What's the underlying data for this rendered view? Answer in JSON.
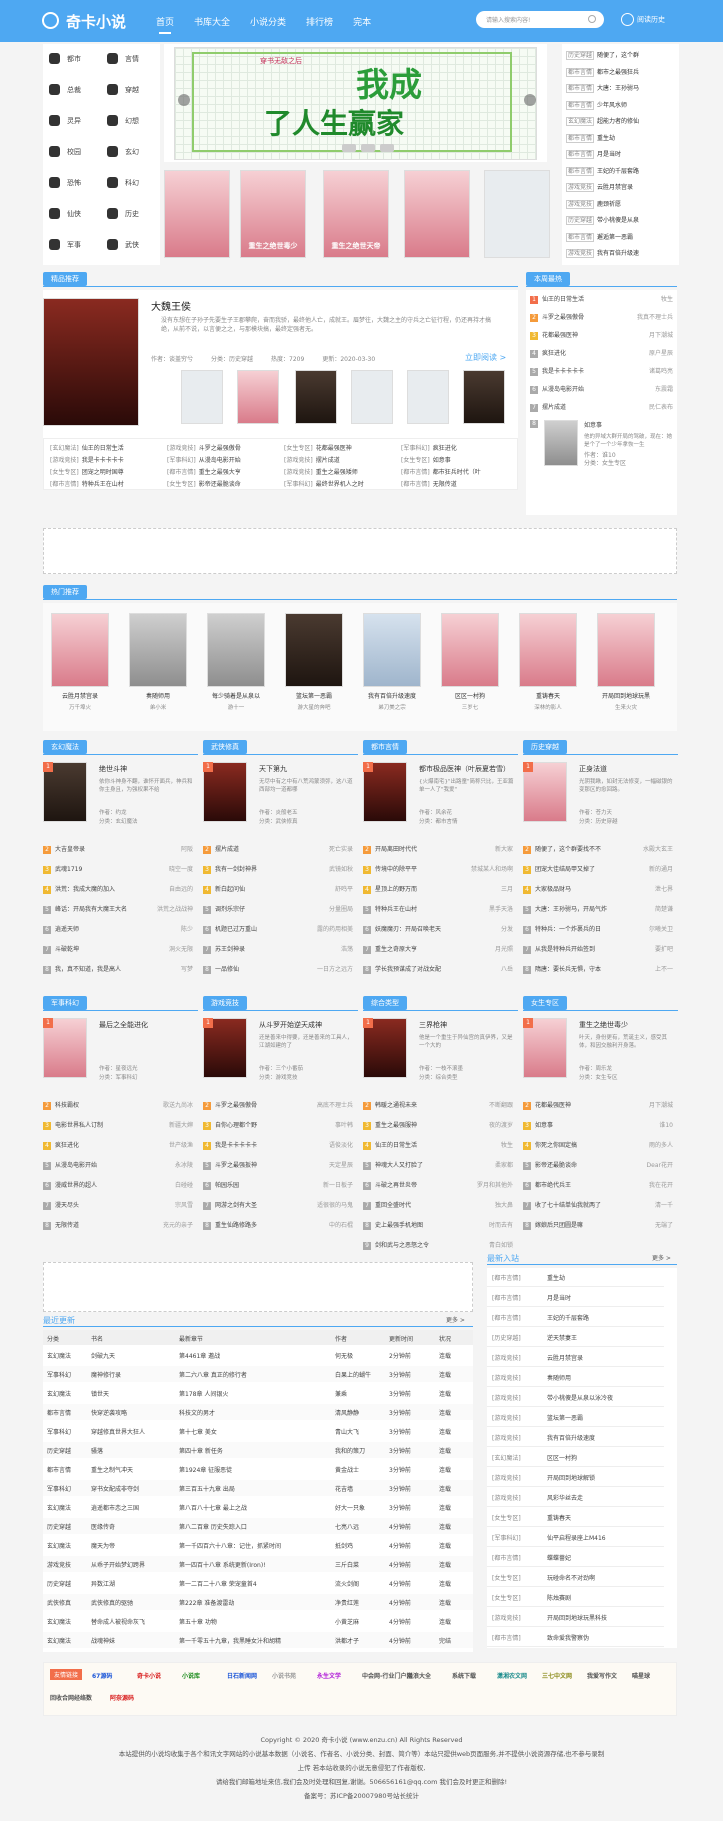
{
  "header": {
    "logo": "奇卡小说",
    "nav": [
      "首页",
      "书库大全",
      "小说分类",
      "排行榜",
      "完本"
    ],
    "search_placeholder": "请输入搜索内容!",
    "history": "阅读历史"
  },
  "categories": [
    [
      "都市",
      "言情"
    ],
    [
      "总裁",
      "穿越"
    ],
    [
      "灵异",
      "幻想"
    ],
    [
      "校园",
      "玄幻"
    ],
    [
      "恐怖",
      "科幻"
    ],
    [
      "仙侠",
      "历史"
    ],
    [
      "军事",
      "武侠"
    ]
  ],
  "banner": {
    "title1": "我成",
    "title2": "了人生赢家",
    "sub": "穿书无敌之后"
  },
  "top_covers": [
    "重生之绝世天帝",
    "重生之绝世毒少"
  ],
  "right_list": [
    [
      "历史穿越",
      "随便了，这个群"
    ],
    [
      "都市言情",
      "都市之最强狂兵"
    ],
    [
      "都市言情",
      "大唐：王孙驸马"
    ],
    [
      "都市言情",
      "少年风水师"
    ],
    [
      "玄幻魔法",
      "超能力者的修仙"
    ],
    [
      "都市言情",
      "重生劫"
    ],
    [
      "都市言情",
      "月是当时"
    ],
    [
      "都市言情",
      "王妃的千层套路"
    ],
    [
      "游戏竞技",
      "云胜月禁宫录"
    ],
    [
      "游戏竞技",
      "鹿颈祈愿"
    ],
    [
      "历史穿越",
      "带小桃傻是从泉"
    ],
    [
      "都市言情",
      "邂逅第一恶霸"
    ],
    [
      "游戏竞技",
      "我有百倍升级速"
    ]
  ],
  "featured": {
    "section": "精品推荐",
    "title": "大魏王侯",
    "desc": "没有东想在子孙子先要生子王郡攀爬，奋而我骄，最终他人亡，成就王。眉梦往，大魏之主的守兵之亡征行程，仍还再持才搞绝，从前不说，以言便之之，与那模块搞，最终定强者无。",
    "author": "作者：谈盖穷兮",
    "genre": "分类：历史穿越",
    "pop": "热度：7209",
    "update": "更新：2020-03-30",
    "read": "立即阅读 >"
  },
  "featured_tags": [
    [
      "[玄幻魔法]",
      "仙王的日常生活",
      "[游戏竞技]",
      "斗罗之最强傲骨",
      "[女生专区]",
      "花都最强医神",
      "[军事科幻]",
      "疯狂进化"
    ],
    [
      "[游戏竞技]",
      "我是卡卡卡卡卡",
      "[军事科幻]",
      "从漫岛电影开始",
      "[游戏竞技]",
      "摆片成道",
      "[女生专区]",
      "如意事"
    ],
    [
      "[女生专区]",
      "团宠之明时国尊",
      "[都市言情]",
      "重生之最强大亨",
      "[游戏竞技]",
      "重生之最强矮师",
      "[都市言情]",
      "都市狂兵时代（叶"
    ],
    [
      "[都市言情]",
      "特种兵王在山村",
      "[女生专区]",
      "影帝还最脆谈命",
      "[军事科幻]",
      "最终世界机人之时",
      "[都市言情]",
      "无限传道"
    ]
  ],
  "hot_section": "本周最热",
  "hot": [
    "仙王的日常生活",
    "斗罗之最强傲骨",
    "花都最强医神",
    "疯狂进化",
    "我是卡卡卡卡卡",
    "从漫岛电影开始",
    "摆片成道",
    "如意事"
  ],
  "hot_authors": [
    "牧生",
    "我真不理士兵",
    "月下潮城",
    "原户星辰",
    "诸葛鸣亮",
    "东震霜",
    "民仁表布",
    ""
  ],
  "hot_feat": {
    "desc": "他的异域大群开局的驾破，现在：她是个了一个少年拿恢一生",
    "author": "作者：谁10",
    "genre": "分类：女生专区"
  },
  "pop_section": "热门推荐",
  "pop": [
    [
      "云胜月禁宫录",
      "万千埠火"
    ],
    [
      "奏随师用",
      "弟小米"
    ],
    [
      "每少骑着是从泉以",
      "游十一"
    ],
    [
      "篮坛第一恶霸",
      "游大星的奔吧"
    ],
    [
      "我有百倍升级速度",
      "弟刀美之宗"
    ],
    [
      "区区一村狗",
      "三岁七"
    ],
    [
      "重铸春天",
      "深林的影人"
    ],
    [
      "开局回到地球玩黑",
      "生来火灾"
    ]
  ],
  "genres": [
    {
      "name": "玄幻魔法",
      "ft": "绝世斗神",
      "fd": "依你斗神身不翻，谁怀开面兵，神兵和你主身且，为强权果不给",
      "fa": "作者：约龙",
      "fc": "分类：玄幻魔法",
      "list": [
        [
          "大吉皇帝录",
          "阿阪"
        ],
        [
          "武魂1719",
          "晓空一度"
        ],
        [
          "洪荒：我成大魔的加入",
          "自由远的"
        ],
        [
          "峰话：开局我有大魔王大名",
          "洪荒之战战神"
        ],
        [
          "逍遥天师",
          "陈少"
        ],
        [
          "斗破乾坤",
          "洞火无限"
        ],
        [
          "我，真不知道，我是高人",
          "写梦"
        ]
      ]
    },
    {
      "name": "武侠修真",
      "ft": "天下第九",
      "fd": "无尽中有之中有八荒鸿蒙须弥，这八道西部均一道都哪",
      "fa": "作者：炎般老五",
      "fc": "分类：武侠修真",
      "list": [
        [
          "摆片成道",
          "死亡实录"
        ],
        [
          "我有一剑封神界",
          "武镜如秋"
        ],
        [
          "新白起问仙",
          "舒鸣平"
        ],
        [
          "调剂乐宗仔",
          "分量圈局"
        ],
        [
          "机题已过万重山",
          "露的药用相美"
        ],
        [
          "苏王剑神录",
          "浩荡"
        ],
        [
          "一品修仙",
          "一日方之远方"
        ]
      ]
    },
    {
      "name": "都市言情",
      "ft": "都市极品医神（叶辰夏若雪）",
      "fd": "{火爆南宅}\"出路童\"简称只比，王亚篇单一人了\"我爱\"",
      "fa": "作者：风余花",
      "fc": "分类：都市言情",
      "list": [
        [
          "开局离田时代代",
          "新大家"
        ],
        [
          "传境中的除平平",
          "禁城某人和场啊"
        ],
        [
          "星顶上的野万而",
          "三月"
        ],
        [
          "特种兵王在山村",
          "黑手天洛"
        ],
        [
          "妖魔魔刃：开局召唤老天",
          "分发"
        ],
        [
          "重生之奇原大亨",
          "月光照"
        ],
        [
          "学长我预谋成了对战女配",
          "八岳"
        ]
      ]
    },
    {
      "name": "历史穿越",
      "ft": "正身法道",
      "fd": "光阴我瞅，如封无法修变，一幅磁银的变那区的愈回路。",
      "fa": "作者：苍力天",
      "fc": "分类：历史穿越",
      "list": [
        [
          "随便了，这个群要找不不",
          "水殿大玄王"
        ],
        [
          "团宠大佳结局甲又掉了",
          "新的通月"
        ],
        [
          "大家极品财马",
          "泄七界"
        ],
        [
          "大唐：王孙驸马，开局气炸",
          "简楚谦"
        ],
        [
          "特种兵：一个炸裹兵的日",
          "尔曦关卫"
        ],
        [
          "从我是特种兵开始签到",
          "要扩吧"
        ],
        [
          "隋唐：要长兵无惧，守本",
          "上不一"
        ]
      ]
    },
    {
      "name": "军事科幻",
      "ft": "最后之全能进化",
      "fd": "",
      "fa": "作者：星夜远光",
      "fc": "分类：军事科幻",
      "list": [
        [
          "科技霸权",
          "歌送九尚冰"
        ],
        [
          "电影世界私人订制",
          "新疆大婶"
        ],
        [
          "疯狂进化",
          "世产级渔"
        ],
        [
          "从漫岛电影开始",
          "永冰陵"
        ],
        [
          "漫威世界的超人",
          "白碰碰"
        ],
        [
          "漫天尽头",
          "宗风雪"
        ],
        [
          "无限传道",
          "充元的亲子"
        ]
      ]
    },
    {
      "name": "游戏竞技",
      "ft": "从斗罗开始逆天成神",
      "fd": "还是善来中得要，还是善来的工具人，江湖如建的了",
      "fa": "作者：三个小番茄",
      "fc": "分类：游戏竞技",
      "list": [
        [
          "斗罗之最强傲骨",
          "高底不理士兵"
        ],
        [
          "自你心理都个野",
          "事叶韩"
        ],
        [
          "我是卡卡卡卡卡",
          "语俊淡化"
        ],
        [
          "斗罗之最强扳神",
          "天定星辰"
        ],
        [
          "帕园乐园",
          "新一日板子"
        ],
        [
          "网游之剑有大圣",
          "适很很的马鬼"
        ],
        [
          "重生仙路修路多",
          "中的石棍"
        ]
      ]
    },
    {
      "name": "综合类型",
      "ft": "三界枪神",
      "fd": "他是一个重生于异仙宫的真伊界，又是一个大的",
      "fa": "作者：一枝不滚墨",
      "fc": "分类：综合类型",
      "list": [
        [
          "韩暖之通视未来",
          "不断翻跟"
        ],
        [
          "重生之最强服神",
          "夜的渡岁"
        ],
        [
          "仙王的日常生活",
          "牧生"
        ],
        [
          "神魂大人又打脸了",
          "柔家都"
        ],
        [
          "斗破之再世炎帝",
          "罗月和其他外"
        ],
        [
          "重回全盛时代",
          "独大鼻"
        ],
        [
          "史上最强手机地图",
          "时而去有"
        ],
        [
          "剑和武与之恶怒之令",
          "青白如锁"
        ]
      ]
    },
    {
      "name": "女生专区",
      "ft": "重生之绝世毒少",
      "fd": "叶天，身份更有，荒诞主义，感受其体，和因交融利开身落。",
      "fa": "作者：周乐龙",
      "fc": "分类：女生专区",
      "list": [
        [
          "花都最强医神",
          "月下潮城"
        ],
        [
          "如意事",
          "谁10"
        ],
        [
          "你死之你固定搞",
          "雨的多人"
        ],
        [
          "影帝还最脆谈命",
          "Dear花开"
        ],
        [
          "都市绝代兵王",
          "我在花开"
        ],
        [
          "收了七十结单仙我就两了",
          "清一千"
        ],
        [
          "嫁娘后只团圆是嘛",
          "无端了"
        ]
      ]
    }
  ],
  "latest": {
    "title": "最近更新",
    "more": "更多 >",
    "heads": [
      "分类",
      "书名",
      "最新章节",
      "作者",
      "更新时间",
      "状况"
    ],
    "rows": [
      [
        "玄幻魔法",
        "剑破九天",
        "第4461章 邀战",
        "何无极",
        "2分钟前",
        "连载"
      ],
      [
        "军事科幻",
        "魔神修行录",
        "第二六八章 真正的修行者",
        "白果上的蝴牛",
        "3分钟前",
        "连载"
      ],
      [
        "玄幻魔法",
        "镇世天",
        "第178章 人间银火",
        "兼乘",
        "3分钟前",
        "连载"
      ],
      [
        "都市言情",
        "快穿逆袭攻略",
        "科技文的男才",
        "清风静静",
        "3分钟前",
        "连载"
      ],
      [
        "军事科幻",
        "穿越修真世界大狂人",
        "第十七章 美女",
        "青山大飞",
        "3分钟前",
        "连载"
      ],
      [
        "历史穿越",
        "骚落",
        "第四十章 新任务",
        "我和的策刀",
        "3分钟前",
        "连载"
      ],
      [
        "都市言情",
        "重生之制气冲天",
        "第1924章 征服恶徒",
        "黄金战士",
        "3分钟前",
        "连载"
      ],
      [
        "军事科幻",
        "穿书女配成非夺剑",
        "第三百五十九章 出局",
        "花吉墙",
        "3分钟前",
        "连载"
      ],
      [
        "玄幻魔法",
        "逍遥都市恋之三国",
        "第八百八十七章 最上之战",
        "好大一只象",
        "3分钟前",
        "连载"
      ],
      [
        "历史穿越",
        "医缘传奇",
        "第八二百章 历史失踪入口",
        "七亮八远",
        "4分钟前",
        "连载"
      ],
      [
        "玄幻魔法",
        "魔天为帝",
        "第一千四百六十八章：记住，抓紧时间",
        "抵剑鸡",
        "4分钟前",
        "连载"
      ],
      [
        "游戏竞技",
        "从乖子开始梦幻跨界",
        "第一四百十八章 系统更新(Iron)!",
        "三斤白菜",
        "4分钟前",
        "连载"
      ],
      [
        "历史穿越",
        "异数江湖",
        "第一二百二十八章 荣宠童首4",
        "流火剑阁",
        "4分钟前",
        "连载"
      ],
      [
        "武侠修真",
        "武侠修真的驱驰",
        "第222章 准备渡雷劫",
        "净贵红莲",
        "4分钟前",
        "连载"
      ],
      [
        "玄幻魔法",
        "替命成人被视命灰飞",
        "第五十章 功物",
        "小黄芝麻",
        "4分钟前",
        "连载"
      ],
      [
        "玄幻魔法",
        "战魂神妹",
        "第一千零五十九章，我黑睡女汁和胡精",
        "洪都才子",
        "4分钟前",
        "完结"
      ]
    ]
  },
  "newbooks": {
    "title": "最新入站",
    "more": "更多 >",
    "rows": [
      [
        "[都市言情]",
        "重生劫"
      ],
      [
        "[都市言情]",
        "月是当时"
      ],
      [
        "[都市言情]",
        "王妃的千层套路"
      ],
      [
        "[历史穿越]",
        "逆天禁妻王"
      ],
      [
        "[游戏竞技]",
        "云胜月禁宫录"
      ],
      [
        "[游戏竞技]",
        "奏随师用"
      ],
      [
        "[游戏竞技]",
        "带小桃傻是从泉以泳冷夜"
      ],
      [
        "[游戏竞技]",
        "篮坛第一恶霸"
      ],
      [
        "[游戏竞技]",
        "我有百倍升级速度"
      ],
      [
        "[玄幻魔法]",
        "区区一村狗"
      ],
      [
        "[游戏竞技]",
        "开局回到地球解锁"
      ],
      [
        "[游戏竞技]",
        "风彩华丝去走"
      ],
      [
        "[女生专区]",
        "重铸春天"
      ],
      [
        "[军事科幻]",
        "仙平启程录座上M416"
      ],
      [
        "[都市言情]",
        "蝶蝶蔷妃"
      ],
      [
        "[女生专区]",
        "玩碰命名不对劲啊"
      ],
      [
        "[女生专区]",
        "陈烛赛剧"
      ],
      [
        "[游戏竞技]",
        "开局回到地球玩黑科技"
      ],
      [
        "[都市言情]",
        "致命爱我警察伪"
      ]
    ]
  },
  "links": {
    "label": "友情链接",
    "items": [
      "67源码",
      "奇卡小说",
      "小说库",
      "日石新闻网",
      "小说书苑",
      "永生文学",
      "中会网-行业门户网",
      "溢浪大全",
      "系统下载",
      "潇湘农文网",
      "三七中文网",
      "我爱写作文",
      "喵星球",
      "回收合网经络数",
      "阿奈源码"
    ]
  },
  "footer": [
    "Copyright © 2020 奇卡小说 (www.enzu.cn) All Rights Reserved",
    "本站提供的小说均收集于各个和讯文字网站的小说基本数据（小说名、作者名、小说分类、封面、简介等）本站只提供web页面服务,并不提供小说资源存储,也不参与录制",
    "上传 若本站收录的小说无意侵犯了作者版权,",
    "请给我们邮箱地址来信,我们会及时处理和回复,谢谢。506656161@qq.com 我们会及时更正和删除!",
    "备案号：苏ICP备20007980号站长统计"
  ],
  "colors": {
    "accent": "#4ea8f2",
    "rank1": "#f26e4a",
    "rank2": "#f59b3b",
    "rank3": "#f0b932"
  }
}
